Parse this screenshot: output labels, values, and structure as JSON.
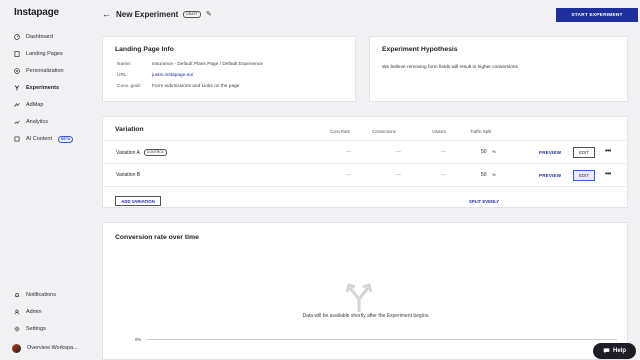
{
  "app": {
    "logo": "Instapage"
  },
  "sidebar": {
    "items": [
      {
        "label": "Dashboard",
        "icon": "gauge-icon"
      },
      {
        "label": "Landing Pages",
        "icon": "pages-icon"
      },
      {
        "label": "Personalization",
        "icon": "personalization-icon"
      },
      {
        "label": "Experiments",
        "icon": "experiments-icon",
        "active": true
      },
      {
        "label": "AdMap",
        "icon": "admap-icon"
      },
      {
        "label": "Analytics",
        "icon": "analytics-icon"
      },
      {
        "label": "AI Content",
        "icon": "ai-icon",
        "badge": "BETA"
      }
    ],
    "bottom": [
      {
        "label": "Notifications",
        "icon": "bell-icon"
      },
      {
        "label": "Admin",
        "icon": "user-icon"
      },
      {
        "label": "Settings",
        "icon": "gear-icon"
      },
      {
        "label": "Overview Workspa...",
        "icon": "avatar"
      }
    ]
  },
  "header": {
    "title": "New Experiment",
    "status_badge": "DRAFT",
    "start_button": "START EXPERIMENT"
  },
  "landing_page_info": {
    "title": "Landing Page Info",
    "name_label": "Name:",
    "name_value": "Insurance - Default Plans Page / Default Experience",
    "url_label": "URL:",
    "url_value": "justin.instapage.eu/",
    "goal_label": "Conv. goal:",
    "goal_value": "Form submissions and Links on the page"
  },
  "hypothesis": {
    "title": "Experiment Hypothesis",
    "text": "We believe removing form fields will result in higher conversions"
  },
  "variations": {
    "title": "Variation",
    "columns": {
      "conv_rate": "Conv.Rate",
      "conversions": "Conversions",
      "visitors": "Visitors",
      "traffic_split": "Traffic Split"
    },
    "rows": [
      {
        "name": "Variation A",
        "badge": "CONTROL",
        "conv_rate": "—",
        "conversions": "—",
        "visitors": "—",
        "split": "50",
        "unit": "%",
        "preview": "PREVIEW",
        "edit": "EDIT",
        "more": "•••"
      },
      {
        "name": "Variation B",
        "badge": "",
        "conv_rate": "—",
        "conversions": "—",
        "visitors": "—",
        "split": "50",
        "unit": "%",
        "preview": "PREVIEW",
        "edit": "EDIT",
        "more": "•••"
      }
    ],
    "add_button": "ADD VARIATION",
    "split_evenly": "SPLIT EVENLY"
  },
  "conversion_chart": {
    "title": "Conversion rate over time",
    "empty_message": "Data will be available shortly after the Experiment begins.",
    "y_tick": "0%"
  },
  "help": {
    "label": "Help"
  }
}
